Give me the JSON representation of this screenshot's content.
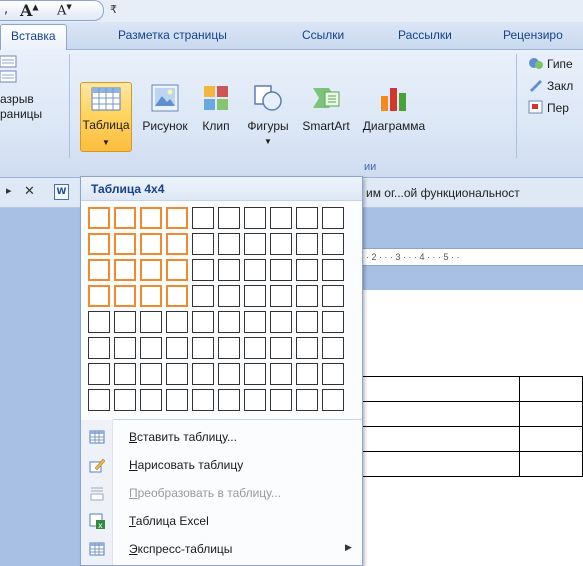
{
  "quick_access": {
    "comma": ",",
    "font_grow_glyph": "A",
    "font_shrink_glyph": "A",
    "dropdown_glyph": "₹"
  },
  "tabs": [
    {
      "label": "Вставка",
      "active": true
    },
    {
      "label": "Разметка страницы"
    },
    {
      "label": "Ссылки"
    },
    {
      "label": "Рассылки"
    },
    {
      "label": "Рецензиро"
    }
  ],
  "ribbon": {
    "page_break": {
      "line1": "азрыв",
      "line2": "раницы"
    },
    "table_button": "Таблица",
    "picture_button": "Рисунок",
    "clip_button": "Клип",
    "shapes_button": "Фигуры",
    "smartart_button": "SmartArt",
    "chart_button": "Диаграмма",
    "illustrations_label_partial": "ии",
    "links_items": [
      "Гипе",
      "Закл",
      "Пер"
    ]
  },
  "document": {
    "title_partial": "им ог...ой функциональност",
    "ruler_text": "· 2 · · · 3 · · · 4 · · · 5 · ·"
  },
  "table_menu": {
    "header": "Таблица 4x4",
    "grid_cols": 10,
    "grid_rows": 8,
    "selected_cols": 4,
    "selected_rows": 4,
    "highlight_color": "#f08a2c",
    "items": [
      {
        "label": "Вставить таблицу...",
        "ul": "В",
        "rest": "ставить таблицу...",
        "icon": "insert-table-icon",
        "disabled": false,
        "submenu": false
      },
      {
        "label": "Нарисовать таблицу",
        "ul": "Н",
        "rest": "арисовать таблицу",
        "icon": "draw-table-icon",
        "disabled": false,
        "submenu": false
      },
      {
        "label": "Преобразовать в таблицу...",
        "ul": "П",
        "rest": "реобразовать в таблицу...",
        "icon": "convert-table-icon",
        "disabled": true,
        "submenu": false
      },
      {
        "label": "Таблица Excel",
        "ul": "Т",
        "rest": "аблица Excel",
        "icon": "excel-table-icon",
        "disabled": false,
        "submenu": false
      },
      {
        "label": "Экспресс-таблицы",
        "ul": "Э",
        "rest": "кспресс-таблицы",
        "icon": "quick-tables-icon",
        "disabled": false,
        "submenu": true
      }
    ]
  }
}
